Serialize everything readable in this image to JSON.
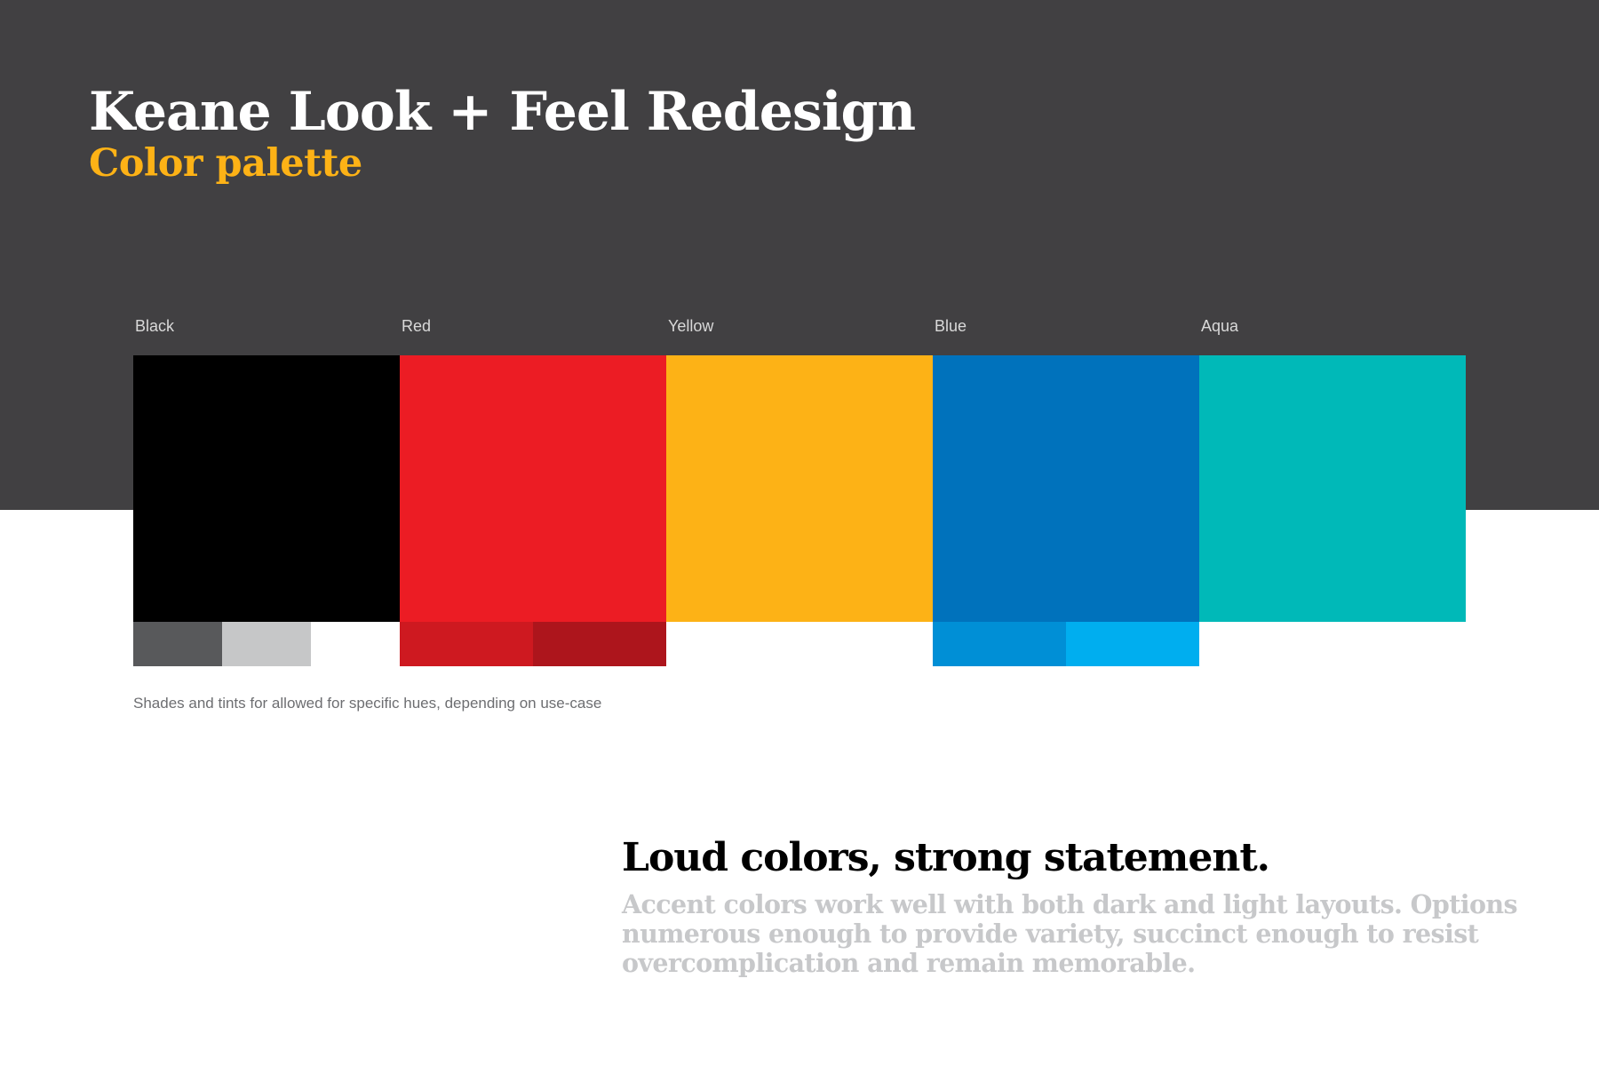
{
  "header": {
    "title": "Keane Look + Feel Redesign",
    "subtitle": "Color palette",
    "subtitle_color": "#FDB216",
    "background_color": "#414042"
  },
  "palette": [
    {
      "name": "Black",
      "color": "#000000",
      "shades": [
        "#58595B",
        "#C6C7C8",
        "#FFFFFF"
      ]
    },
    {
      "name": "Red",
      "color": "#EC1C24",
      "shades": [
        "#CE1920",
        "#AD151C"
      ]
    },
    {
      "name": "Yellow",
      "color": "#FDB216",
      "shades": []
    },
    {
      "name": "Blue",
      "color": "#0072BC",
      "shades": [
        "#008FD6",
        "#00AEEF"
      ]
    },
    {
      "name": "Aqua",
      "color": "#00B9B8",
      "shades": []
    }
  ],
  "caption": "Shades and tints for allowed for specific hues, depending on use-case",
  "statement": {
    "heading": "Loud colors, strong statement.",
    "body": "Accent colors work well with both dark and light layouts. Options numerous enough to provide variety, succinct enough to resist overcomplication and remain memorable."
  }
}
